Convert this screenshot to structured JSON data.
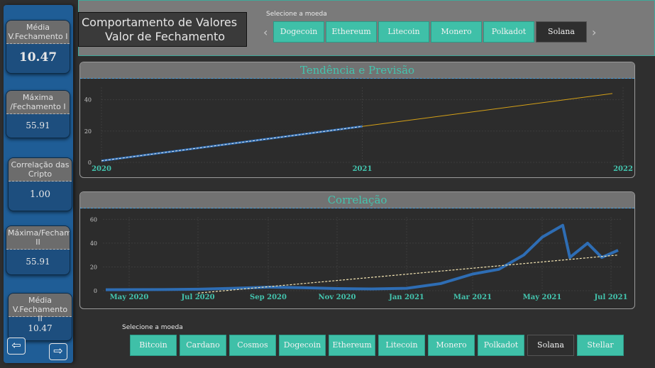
{
  "sidebar": {
    "kpis": [
      {
        "label": "Média V.Fechamento I",
        "value": "10.47"
      },
      {
        "label": "Máxima /Fechamento I",
        "value": "55.91"
      },
      {
        "label": "Correlação das Cripto",
        "value": "1.00"
      },
      {
        "label": "Máxima/Fechamento II",
        "value": "55.91"
      },
      {
        "label": "Média V.Fechamento II",
        "value": "10.47"
      }
    ],
    "prev_glyph": "⇦",
    "next_glyph": "⇨"
  },
  "header": {
    "title_line1": "Comportamento de Valores",
    "title_line2": "Valor de Fechamento",
    "select_label": "Selecione a moeda",
    "coins": [
      "Dogecoin",
      "Ethereum",
      "Litecoin",
      "Monero",
      "Polkadot",
      "Solana"
    ],
    "active_coin": "Solana",
    "chev_left": "‹",
    "chev_right": "›"
  },
  "bottom": {
    "select_label": "Selecione a moeda",
    "coins": [
      "Bitcoin",
      "Cardano",
      "Cosmos",
      "Dogecoin",
      "Ethereum",
      "Litecoin",
      "Monero",
      "Polkadot",
      "Solana",
      "Stellar"
    ],
    "active_coin": "Solana"
  },
  "colors": {
    "accent": "#3fc0a8",
    "series_blue": "#2e6db4",
    "forecast": "#d4a017",
    "trend_dash": "#f5e6b3"
  },
  "chart_data": [
    {
      "type": "line",
      "title": "Tendência e Previsão",
      "x_ticks": [
        "2020",
        "2021",
        "2022"
      ],
      "y_ticks": [
        0,
        20,
        40
      ],
      "ylim": [
        0,
        48
      ],
      "grid": true,
      "series": [
        {
          "x": [
            "2020",
            "2021"
          ],
          "values": [
            1,
            23
          ]
        },
        {
          "x": [
            "2021",
            "2022"
          ],
          "values": [
            23,
            44
          ]
        }
      ]
    },
    {
      "type": "line",
      "title": "Correlação",
      "x_ticks": [
        "May 2020",
        "Jul 2020",
        "Sep 2020",
        "Nov 2020",
        "Jan 2021",
        "Mar 2021",
        "May 2021",
        "Jul 2021"
      ],
      "y_ticks": [
        0,
        20,
        40,
        60
      ],
      "ylim": [
        0,
        62
      ],
      "grid": true,
      "series": [
        {
          "x": [
            "Apr 2020",
            "May 2020",
            "Jun 2020",
            "Jul 2020",
            "Aug 2020",
            "Sep 2020",
            "Oct 2020",
            "Nov 2020",
            "Dec 2020",
            "Jan 2021",
            "Feb 2021",
            "Mar 2021",
            "Apr 2021",
            "Apr 2021b",
            "May 2021",
            "May 2021b",
            "May 2021c",
            "Jun 2021",
            "Jun 2021b",
            "Jul 2021"
          ],
          "values": [
            0.8,
            0.9,
            1,
            1.3,
            2,
            3,
            2.5,
            1.8,
            1.5,
            2,
            6,
            14,
            18,
            30,
            45,
            55,
            28,
            40,
            28,
            34
          ]
        },
        {
          "x": [
            "Jul 2020",
            "Jul 2021"
          ],
          "values": [
            -2,
            30
          ]
        }
      ]
    }
  ]
}
